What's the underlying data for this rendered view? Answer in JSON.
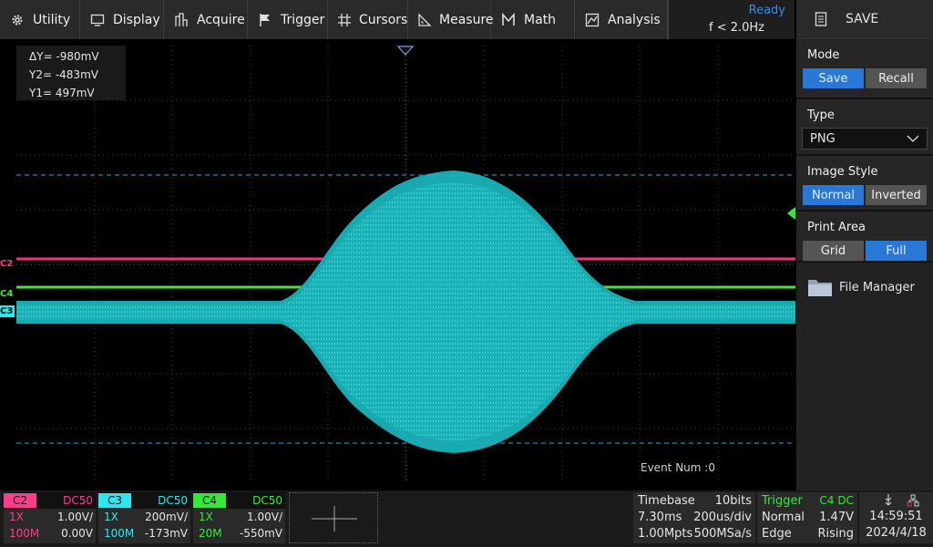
{
  "menu": {
    "items": [
      {
        "label": "Utility",
        "icon": "gear-icon"
      },
      {
        "label": "Display",
        "icon": "monitor-icon"
      },
      {
        "label": "Acquire",
        "icon": "acquire-icon"
      },
      {
        "label": "Trigger",
        "icon": "flag-icon"
      },
      {
        "label": "Cursors",
        "icon": "cursor-cross-icon"
      },
      {
        "label": "Measure",
        "icon": "measure-icon"
      },
      {
        "label": "Math",
        "icon": "math-icon"
      },
      {
        "label": "Analysis",
        "icon": "analysis-icon"
      }
    ],
    "status": "Ready",
    "freq": "f < 2.0Hz"
  },
  "panel": {
    "title": "SAVE",
    "mode": {
      "label": "Mode",
      "options": [
        "Save",
        "Recall"
      ],
      "selected": "Save"
    },
    "type": {
      "label": "Type",
      "value": "PNG"
    },
    "image_style": {
      "label": "Image Style",
      "options": [
        "Normal",
        "Inverted"
      ],
      "selected": "Normal"
    },
    "print_area": {
      "label": "Print Area",
      "options": [
        "Grid",
        "Full"
      ],
      "selected": "Full"
    },
    "file_manager": "File Manager"
  },
  "cursor_readout": {
    "dy": "ΔY= -980mV",
    "y2": "Y2= -483mV",
    "y1": "Y1= 497mV"
  },
  "event_num": "Event Num :0",
  "markers": {
    "c2": "C2",
    "c4": "C4",
    "c3": "C3"
  },
  "channels": [
    {
      "name": "C2",
      "coupling": "DC50",
      "probe": "1X",
      "scale": "1.00V/",
      "bw": "100M",
      "offset": "0.00V",
      "color": "#ff3d8a"
    },
    {
      "name": "C3",
      "coupling": "DC50",
      "probe": "1X",
      "scale": "200mV/",
      "bw": "100M",
      "offset": "-173mV",
      "color": "#2ee6f0"
    },
    {
      "name": "C4",
      "coupling": "DC50",
      "probe": "1X",
      "scale": "1.00V/",
      "bw": "20M",
      "offset": "-550mV",
      "color": "#35e83a"
    }
  ],
  "timebase": {
    "label": "Timebase",
    "bits": "10bits",
    "delay": "7.30ms",
    "scale": "200us/div",
    "depth": "1.00Mpts",
    "rate": "500MSa/s"
  },
  "trigger": {
    "label": "Trigger",
    "source": "C4 DC",
    "mode": "Normal",
    "level": "1.47V",
    "type": "Edge",
    "slope": "Rising"
  },
  "clock": {
    "time": "14:59:51",
    "date": "2024/4/18"
  }
}
